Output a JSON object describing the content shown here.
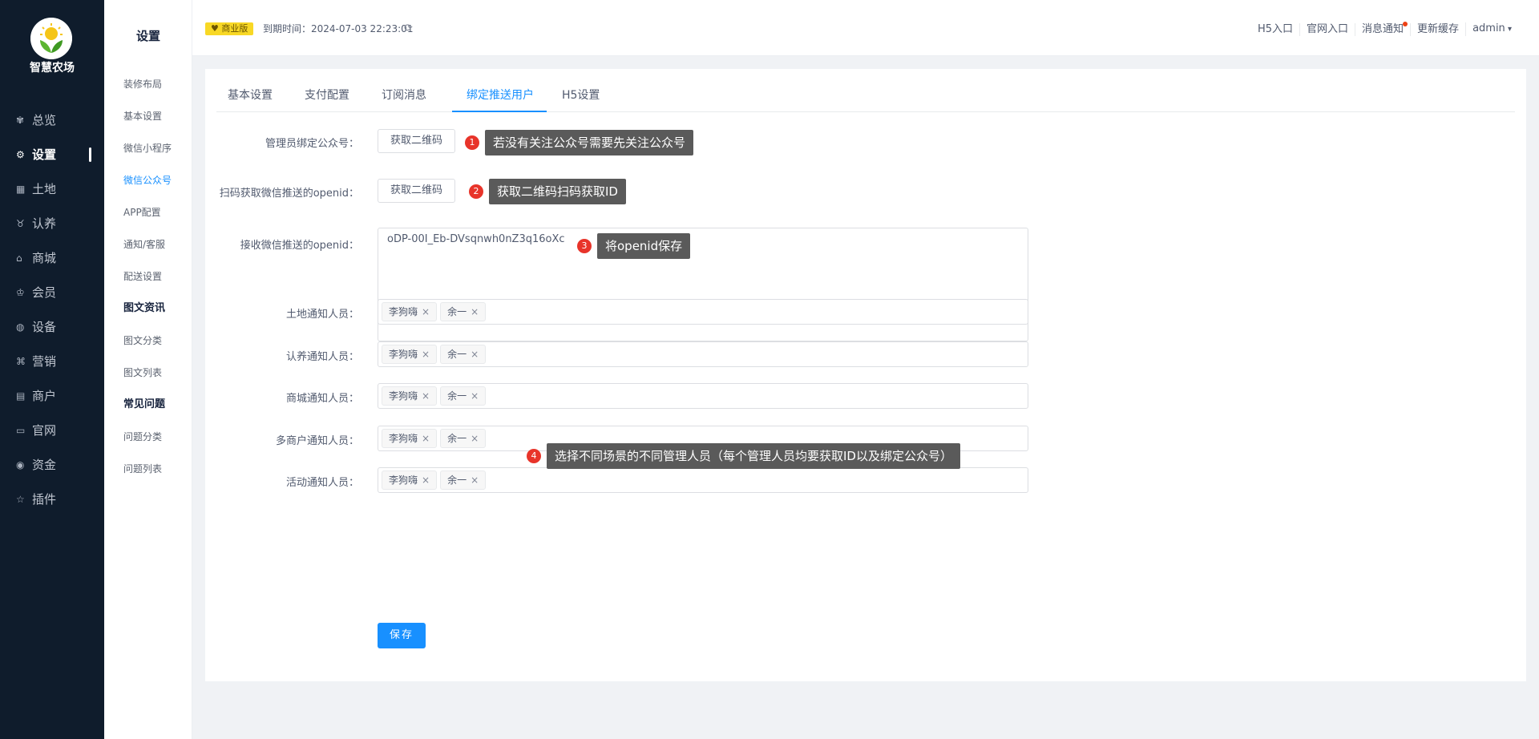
{
  "brand": {
    "name": "智慧农场"
  },
  "nav": [
    {
      "icon": "dashboard-icon",
      "glyph": "✾",
      "label": "总览"
    },
    {
      "icon": "gear-icon",
      "glyph": "⚙",
      "label": "设置",
      "active": true
    },
    {
      "icon": "grid-icon",
      "glyph": "▦",
      "label": "土地"
    },
    {
      "icon": "adopt-icon",
      "glyph": "♉",
      "label": "认养"
    },
    {
      "icon": "shop-icon",
      "glyph": "⌂",
      "label": "商城"
    },
    {
      "icon": "member-icon",
      "glyph": "♔",
      "label": "会员"
    },
    {
      "icon": "device-icon",
      "glyph": "◍",
      "label": "设备"
    },
    {
      "icon": "marketing-icon",
      "glyph": "⌘",
      "label": "营销"
    },
    {
      "icon": "merchant-icon",
      "glyph": "▤",
      "label": "商户"
    },
    {
      "icon": "website-icon",
      "glyph": "▭",
      "label": "官网"
    },
    {
      "icon": "funds-icon",
      "glyph": "◉",
      "label": "资金"
    },
    {
      "icon": "plugin-icon",
      "glyph": "☆",
      "label": "插件"
    }
  ],
  "submenu": {
    "title": "设置",
    "items": [
      {
        "label": "装修布局"
      },
      {
        "label": "基本设置"
      },
      {
        "label": "微信小程序"
      },
      {
        "label": "微信公众号",
        "active": true
      },
      {
        "label": "APP配置"
      },
      {
        "label": "通知/客服"
      },
      {
        "label": "配送设置"
      },
      {
        "label": "图文资讯",
        "group": true
      },
      {
        "label": "图文分类"
      },
      {
        "label": "图文列表"
      },
      {
        "label": "常见问题",
        "group": true
      },
      {
        "label": "问题分类"
      },
      {
        "label": "问题列表"
      }
    ]
  },
  "header": {
    "badge": "商业版",
    "expire": "到期时间：2024-07-03 22:23:01",
    "links": [
      "H5入口",
      "官网入口",
      "消息通知",
      "更新缓存"
    ],
    "user": "admin"
  },
  "tabs": [
    "基本设置",
    "支付配置",
    "订阅消息",
    "绑定推送用户",
    "H5设置"
  ],
  "active_tab": "绑定推送用户",
  "form": {
    "bind_label": "管理员绑定公众号：",
    "bind_button": "获取二维码",
    "scan_label": "扫码获取微信推送的openid：",
    "scan_button": "获取二维码",
    "openid_label": "接收微信推送的openid：",
    "openid_value": "oDP-00I_Eb-DVsqnwh0nZ3q16oXc",
    "notify_rows": [
      {
        "label": "土地通知人员：",
        "tags": [
          "李狗嗨",
          "余一"
        ]
      },
      {
        "label": "认养通知人员：",
        "tags": [
          "李狗嗨",
          "余一"
        ]
      },
      {
        "label": "商城通知人员：",
        "tags": [
          "李狗嗨",
          "余一"
        ]
      },
      {
        "label": "多商户通知人员：",
        "tags": [
          "李狗嗨",
          "余一"
        ]
      },
      {
        "label": "活动通知人员：",
        "tags": [
          "李狗嗨",
          "余一"
        ]
      }
    ],
    "save": "保存"
  },
  "notes": [
    {
      "num": "1",
      "text": "若没有关注公众号需要先关注公众号"
    },
    {
      "num": "2",
      "text": "获取二维码扫码获取ID"
    },
    {
      "num": "3",
      "text": "将openid保存"
    },
    {
      "num": "4",
      "text": "选择不同场景的不同管理人员（每个管理人员均要获取ID以及绑定公众号）"
    }
  ]
}
